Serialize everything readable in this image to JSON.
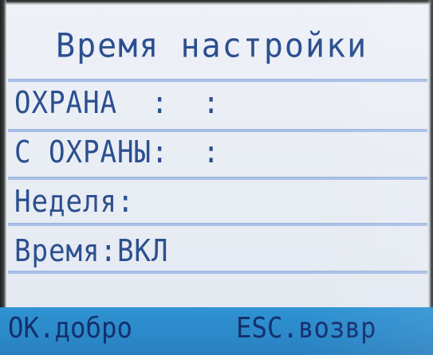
{
  "screen": {
    "title": "Время настройки",
    "rows": [
      {
        "label": "ОХРАНА  :  :"
      },
      {
        "label": "С ОХРАНЫ:  :"
      },
      {
        "label": "Неделя:"
      },
      {
        "label": "Время:ВКЛ"
      }
    ],
    "footer": {
      "ok_label": "ОК.добро",
      "esc_label": "ESC.возвр"
    }
  },
  "colors": {
    "lcd_background": "#eaeef5",
    "text": "#2b4f8f",
    "separator": "#a9c0e6",
    "footer_bar": "#2b88c9",
    "footer_text": "#16306e"
  }
}
